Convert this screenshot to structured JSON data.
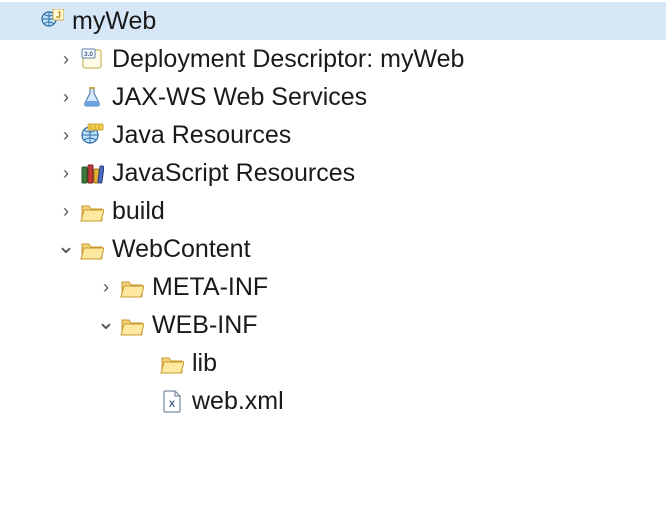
{
  "tree": {
    "root": {
      "label": "myWeb",
      "icon": "web-project-icon",
      "expanded": true,
      "selected": true,
      "children": [
        {
          "label": "Deployment Descriptor: myWeb",
          "icon": "descriptor-icon",
          "expanded": false,
          "children": [],
          "hasChildren": true
        },
        {
          "label": "JAX-WS Web Services",
          "icon": "webservice-icon",
          "expanded": false,
          "children": [],
          "hasChildren": true
        },
        {
          "label": "Java Resources",
          "icon": "java-resources-icon",
          "expanded": false,
          "children": [],
          "hasChildren": true
        },
        {
          "label": "JavaScript Resources",
          "icon": "js-resources-icon",
          "expanded": false,
          "children": [],
          "hasChildren": true
        },
        {
          "label": "build",
          "icon": "folder-icon",
          "expanded": false,
          "children": [],
          "hasChildren": true
        },
        {
          "label": "WebContent",
          "icon": "folder-icon",
          "expanded": true,
          "hasChildren": true,
          "children": [
            {
              "label": "META-INF",
              "icon": "folder-icon",
              "expanded": false,
              "hasChildren": true,
              "children": []
            },
            {
              "label": "WEB-INF",
              "icon": "folder-icon",
              "expanded": true,
              "hasChildren": true,
              "children": [
                {
                  "label": "lib",
                  "icon": "folder-icon",
                  "expanded": false,
                  "hasChildren": false,
                  "children": []
                },
                {
                  "label": "web.xml",
                  "icon": "xml-file-icon",
                  "expanded": false,
                  "hasChildren": false,
                  "children": []
                }
              ]
            }
          ]
        }
      ]
    }
  },
  "indentPx": 40,
  "baseIndentPx": 16
}
